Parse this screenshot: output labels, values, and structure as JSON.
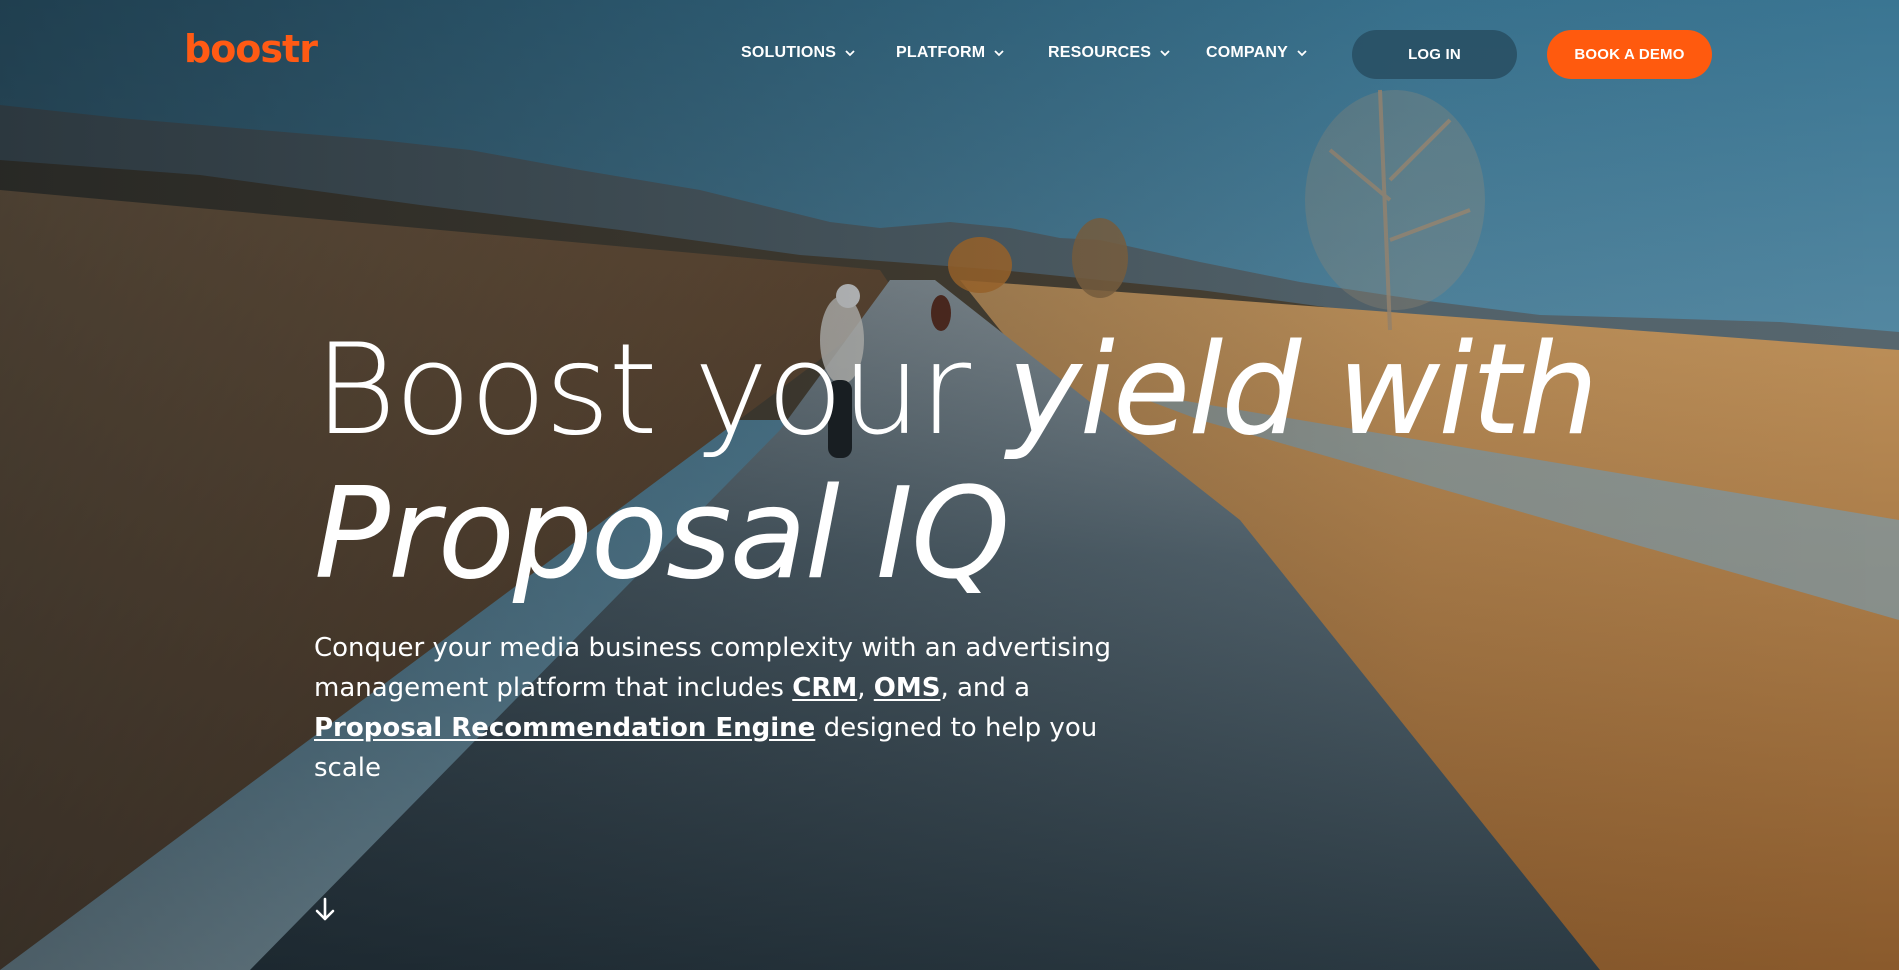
{
  "brand": {
    "logo_text": "boostr",
    "accent": "#ff5a0e"
  },
  "nav": {
    "items": [
      {
        "label": "SOLUTIONS",
        "icon": "chevron-down-icon"
      },
      {
        "label": "PLATFORM",
        "icon": "chevron-down-icon"
      },
      {
        "label": "RESOURCES",
        "icon": "chevron-down-icon"
      },
      {
        "label": "COMPANY",
        "icon": "chevron-down-icon"
      }
    ],
    "login_label": "LOG IN",
    "demo_label": "BOOK A DEMO"
  },
  "hero": {
    "headline_part1": "Boost your ",
    "headline_part2": "yield with",
    "headline_part3": "Proposal IQ",
    "sub_text_1": "Conquer your media business complexity with an advertising management platform that includes ",
    "link_crm": "CRM",
    "sep_1": ", ",
    "link_oms": "OMS",
    "sep_2": ", and a ",
    "link_pre": "Proposal Recommendation Engine",
    "sub_text_2": " designed to help you scale",
    "scroll_icon": "arrow-down-icon"
  }
}
